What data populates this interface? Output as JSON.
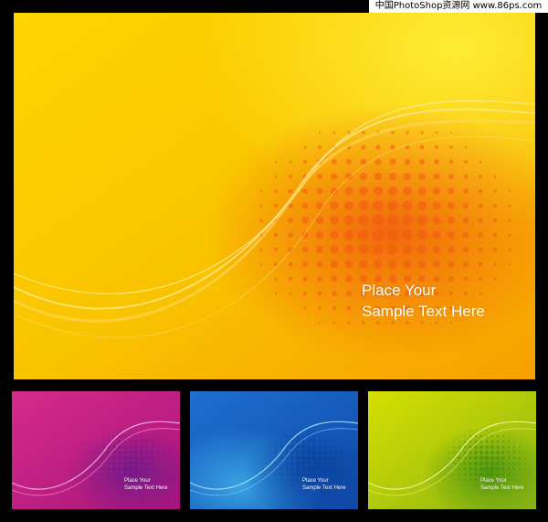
{
  "watermark": "中国PhotoShop资源网 www.86ps.com",
  "main_card": {
    "caption_line1": "Place Your",
    "caption_line2": "Sample Text Here",
    "colors": {
      "base": "#f7c000",
      "highlight": "#fff640",
      "accent": "#f05a10"
    }
  },
  "thumbnails": [
    {
      "caption_line1": "Place Your",
      "caption_line2": "Sample Text Here",
      "colors": {
        "base": "#c21a7c",
        "highlight": "#ff4fb0",
        "accent": "#6c1a8c"
      }
    },
    {
      "caption_line1": "Place Your",
      "caption_line2": "Sample Text Here",
      "colors": {
        "base": "#1f7fd8",
        "highlight": "#4fd4ff",
        "accent": "#0a3f9c"
      }
    },
    {
      "caption_line1": "Place Your",
      "caption_line2": "Sample Text Here",
      "colors": {
        "base": "#a6c818",
        "highlight": "#f2f200",
        "accent": "#3a8a10"
      }
    }
  ]
}
